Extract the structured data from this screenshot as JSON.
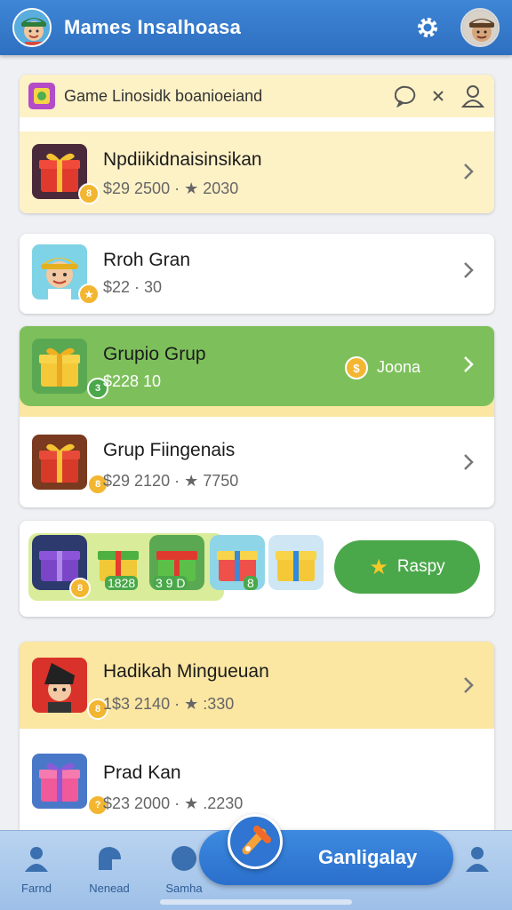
{
  "header": {
    "title": "Mames Insalhoasa"
  },
  "search": {
    "text": "Game Linosidk  boanioeiand"
  },
  "items": [
    {
      "title": "Npdiikidnaisinsikan",
      "sub": "$29 2500 · ★ 2030"
    },
    {
      "title": "Rroh Gran",
      "sub": "$22 · 30"
    },
    {
      "title": "Grupio Grup",
      "sub": "$228 10",
      "reward": "Joona",
      "badge": "3"
    },
    {
      "title": "Grup Fiingenais",
      "sub": "$29 2120 · ★ 7750"
    },
    {
      "title": "Hadikah Mingueuan",
      "sub": "1$3 2140 · ★ :330"
    },
    {
      "title": "Prad Kan",
      "sub": "$23 2000 · ★ .2230"
    }
  ],
  "gift_row": {
    "labels": [
      "1828",
      "3 9 D",
      "8"
    ],
    "redeem_label": "Raspy"
  },
  "bottom_nav": {
    "items": [
      "Farnd",
      "Nenead",
      "Samha"
    ],
    "primary_label": "Ganligalay"
  },
  "colors": {
    "accent": "#2e6fc0",
    "green": "#7dc05b",
    "highlight": "#fdeaa0"
  }
}
